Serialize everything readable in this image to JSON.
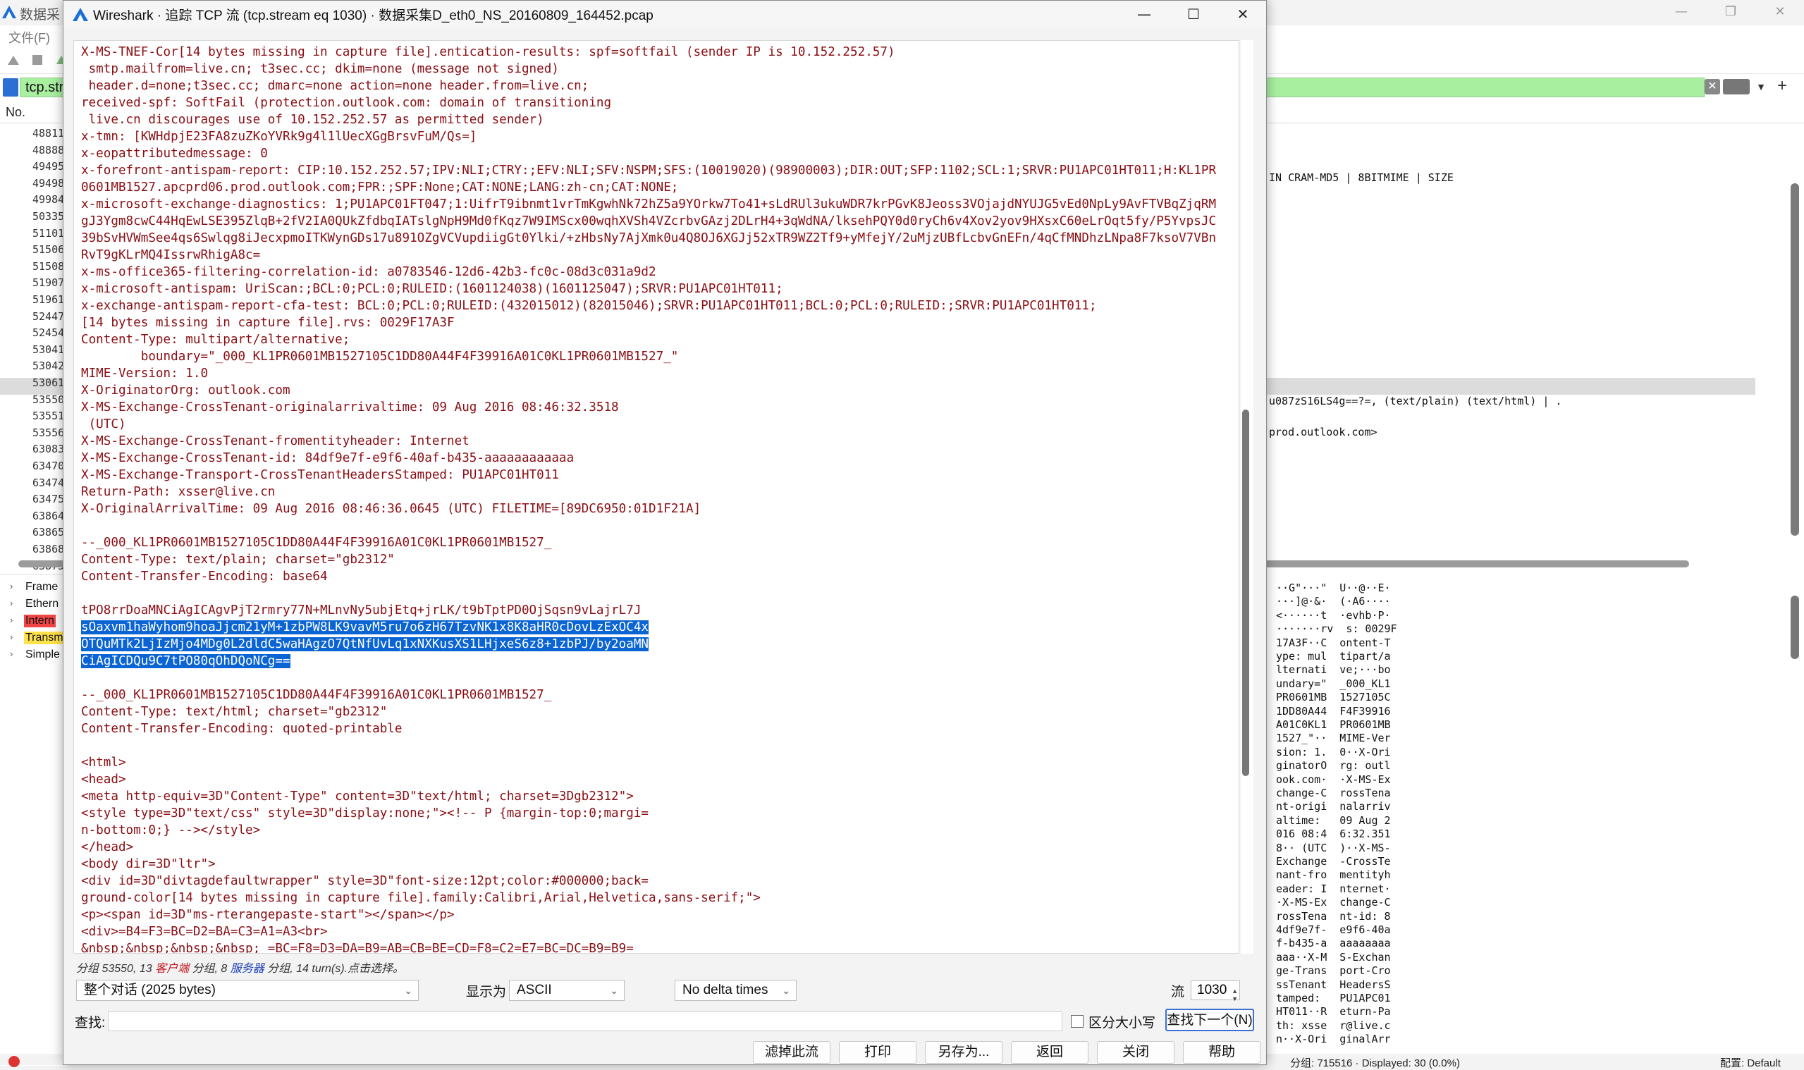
{
  "background_window": {
    "title": "数据采",
    "menu_file": "文件(F)",
    "filter_text": "tcp.str",
    "col_no": "No.",
    "packet_numbers": [
      "48811",
      "48888",
      "49495",
      "49498",
      "49984",
      "50335",
      "51101",
      "51506",
      "51508",
      "51907",
      "51961",
      "52447",
      "52454",
      "53041",
      "53042",
      "53061",
      "53550",
      "53551",
      "53556",
      "63083",
      "63470",
      "63474",
      "63475",
      "63864",
      "63865",
      "63868",
      "63875"
    ],
    "info_lines": [
      "IN CRAM-MD5 | 8BITMIME | SIZE",
      "u087zS16LS4g==?=,  (text/plain) (text/html) | .",
      "prod.outlook.com>"
    ],
    "tree_items": [
      {
        "label": "Frame",
        "style": "plain"
      },
      {
        "label": "Ethern",
        "style": "plain"
      },
      {
        "label": "Intern",
        "style": "red"
      },
      {
        "label": "Transm",
        "style": "yellow"
      },
      {
        "label": "Simple",
        "style": "plain"
      }
    ],
    "bytes_lines": [
      "··G\"···\"  U··@··E·",
      "···]@·&·  (·A6····",
      "<······t  ·evhb·P·",
      "·······rv  s: 0029F",
      "17A3F··C  ontent-T",
      "ype: mul  tipart/a",
      "lternati  ve;···bo",
      "undary=\"  _000_KL1",
      "PR0601MB  1527105C",
      "1DD80A44  F4F39916",
      "A01C0KL1  PR0601MB",
      "1527_\"··  MIME-Ver",
      "sion: 1.  0··X-Ori",
      "ginatorO  rg: outl",
      "ook.com·  ·X-MS-Ex",
      "change-C  rossTena",
      "nt-origi  nalarriv",
      "altime:   09 Aug 2",
      "016 08:4  6:32.351",
      "8·· (UTC  )··X-MS-",
      "Exchange  -CrossTe",
      "nant-fro  mentityh",
      "eader: I  nternet·",
      "·X-MS-Ex  change-C",
      "rossTena  nt-id: 8",
      "4df9e7f-  e9f6-40a",
      "f-b435-a  aaaaaaaa",
      "aaa··X-M  S-Exchan",
      "ge-Trans  port-Cro",
      "ssTenant  HeadersS",
      "tamped:   PU1APC01",
      "HT011··R  eturn-Pa",
      "th: xsse  r@live.c",
      "n··X-Ori  ginalArr"
    ],
    "status_text": "分组: 715516 · Displayed: 30 (0.0%)",
    "status_right": "配置: Default"
  },
  "dialog": {
    "title": "Wireshark · 追踪 TCP 流 (tcp.stream eq 1030) · 数据采集D_eth0_NS_20160809_164452.pcap",
    "stream_lines": [
      "X-MS-TNEF-Cor[14 bytes missing in capture file].entication-results: spf=softfail (sender IP is 10.152.252.57)",
      " smtp.mailfrom=live.cn; t3sec.cc; dkim=none (message not signed)",
      " header.d=none;t3sec.cc; dmarc=none action=none header.from=live.cn;",
      "received-spf: SoftFail (protection.outlook.com: domain of transitioning",
      " live.cn discourages use of 10.152.252.57 as permitted sender)",
      "x-tmn: [KWHdpjE23FA8zuZKoYVRk9g4l1lUecXGgBrsvFuM/Qs=]",
      "x-eopattributedmessage: 0",
      "x-forefront-antispam-report: CIP:10.152.252.57;IPV:NLI;CTRY:;EFV:NLI;SFV:NSPM;SFS:(10019020)(98900003);DIR:OUT;SFP:1102;SCL:1;SRVR:PU1APC01HT011;H:KL1PR",
      "0601MB1527.apcprd06.prod.outlook.com;FPR:;SPF:None;CAT:NONE;LANG:zh-cn;CAT:NONE;",
      "x-microsoft-exchange-diagnostics: 1;PU1APC01FT047;1:UifrT9ibnmt1vrTmKgwhNk72hZ5a9YOrkw7To41+sLdRUl3ukuWDR7krPGvK8Jeoss3VOjajdNYUJG5vEd0NpLy9AvFTVBqZjqRM",
      "gJ3Ygm8cwC44HqEwLSE395ZlqB+2fV2IA0QUkZfdbqIATslgNpH9Md0fKqz7W9IMScx00wqhXVSh4VZcrbvGAzj2DLrH4+3qWdNA/lksehPQY0d0ryCh6v4Xov2yov9HXsxC60eLrOqt5fy/P5YvpsJC",
      "39bSvHVWmSee4qs6Swlqg8iJecxpmoITKWynGDs17u891OZgVCVupdiigGt0Ylki/+zHbsNy7AjXmk0u4Q8OJ6XGJj52xTR9WZ2Tf9+yMfejY/2uMjzUBfLcbvGnEFn/4qCfMNDhzLNpa8F7ksoV7VBn",
      "RvT9gKLrMQ4IssrwRhigA8c=",
      "x-ms-office365-filtering-correlation-id: a0783546-12d6-42b3-fc0c-08d3c031a9d2",
      "x-microsoft-antispam: UriScan:;BCL:0;PCL:0;RULEID:(1601124038)(1601125047);SRVR:PU1APC01HT011;",
      "x-exchange-antispam-report-cfa-test: BCL:0;PCL:0;RULEID:(432015012)(82015046);SRVR:PU1APC01HT011;BCL:0;PCL:0;RULEID:;SRVR:PU1APC01HT011;",
      "[14 bytes missing in capture file].rvs: 0029F17A3F",
      "Content-Type: multipart/alternative;",
      "\tboundary=\"_000_KL1PR0601MB1527105C1DD80A44F4F39916A01C0KL1PR0601MB1527_\"",
      "MIME-Version: 1.0",
      "X-OriginatorOrg: outlook.com",
      "X-MS-Exchange-CrossTenant-originalarrivaltime: 09 Aug 2016 08:46:32.3518",
      " (UTC)",
      "X-MS-Exchange-CrossTenant-fromentityheader: Internet",
      "X-MS-Exchange-CrossTenant-id: 84df9e7f-e9f6-40af-b435-aaaaaaaaaaaa",
      "X-MS-Exchange-Transport-CrossTenantHeadersStamped: PU1APC01HT011",
      "Return-Path: xsser@live.cn",
      "X-OriginalArrivalTime: 09 Aug 2016 08:46:36.0645 (UTC) FILETIME=[89DC6950:01D1F21A]",
      "",
      "--_000_KL1PR0601MB1527105C1DD80A44F4F39916A01C0KL1PR0601MB1527_",
      "Content-Type: text/plain; charset=\"gb2312\"",
      "Content-Transfer-Encoding: base64",
      "",
      "tPO8rrDoaMNCiAgICAgvPjT2rmry77N+MLnvNy5ubjEtq+jrLK/t9bTptPD0OjSqsn9vLajrL7J",
      "sOaxvm1haWyhom9hoaJjcm21yM+1zbPW8LK9vavM5ru7o6zH67TzvNK1x8K8aHR0cDovLzExOC4x",
      "OTQuMTk2LjIzMjo4MDg0L2dldC5waHAgzO7QtNfUvLq1xNXKusXS1LHjxeS6z8+1zbPJ/by2oaMN",
      "CiAgICDQu9C7tPO80qOhDQoNCg==",
      "",
      "--_000_KL1PR0601MB1527105C1DD80A44F4F39916A01C0KL1PR0601MB1527_",
      "Content-Type: text/html; charset=\"gb2312\"",
      "Content-Transfer-Encoding: quoted-printable",
      "",
      "<html>",
      "<head>",
      "<meta http-equiv=3D\"Content-Type\" content=3D\"text/html; charset=3Dgb2312\">",
      "<style type=3D\"text/css\" style=3D\"display:none;\"><!-- P {margin-top:0;margi=",
      "n-bottom:0;} --></style>",
      "</head>",
      "<body dir=3D\"ltr\">",
      "<div id=3D\"divtagdefaultwrapper\" style=3D\"font-size:12pt;color:#000000;back=",
      "ground-color[14 bytes missing in capture file].family:Calibri,Arial,Helvetica,sans-serif;\">",
      "<p><span id=3D\"ms-rterangepaste-start\"></span></p>",
      "<div>=B4=F3=BC=D2=BA=C3=A1=A3<br>",
      "&nbsp;&nbsp;&nbsp;&nbsp; =BC=F8=D3=DA=B9=AB=CB=BE=CD=F8=C2=E7=BC=DC=B9=B9="
    ],
    "highlight_from": 34,
    "highlight_to": 37,
    "info": {
      "prefix": "分组 53550, 13 ",
      "client": "客户端",
      "mid": " 分组, 8 ",
      "server": "服务器",
      "suffix": " 分组, 14 turn(s).点击选择。"
    },
    "conversation_select": "整个对话 (2025 bytes)",
    "show_as_label": "显示为",
    "show_as_value": "ASCII",
    "delta_value": "No delta times",
    "stream_label": "流",
    "stream_value": "1030",
    "find_label": "查找:",
    "find_value": "",
    "case_label": "区分大小写",
    "find_next": "查找下一个(N)",
    "buttons": {
      "filter_out": "滤掉此流",
      "print": "打印",
      "save_as": "另存为...",
      "back": "返回",
      "close": "关闭",
      "help": "帮助"
    }
  }
}
